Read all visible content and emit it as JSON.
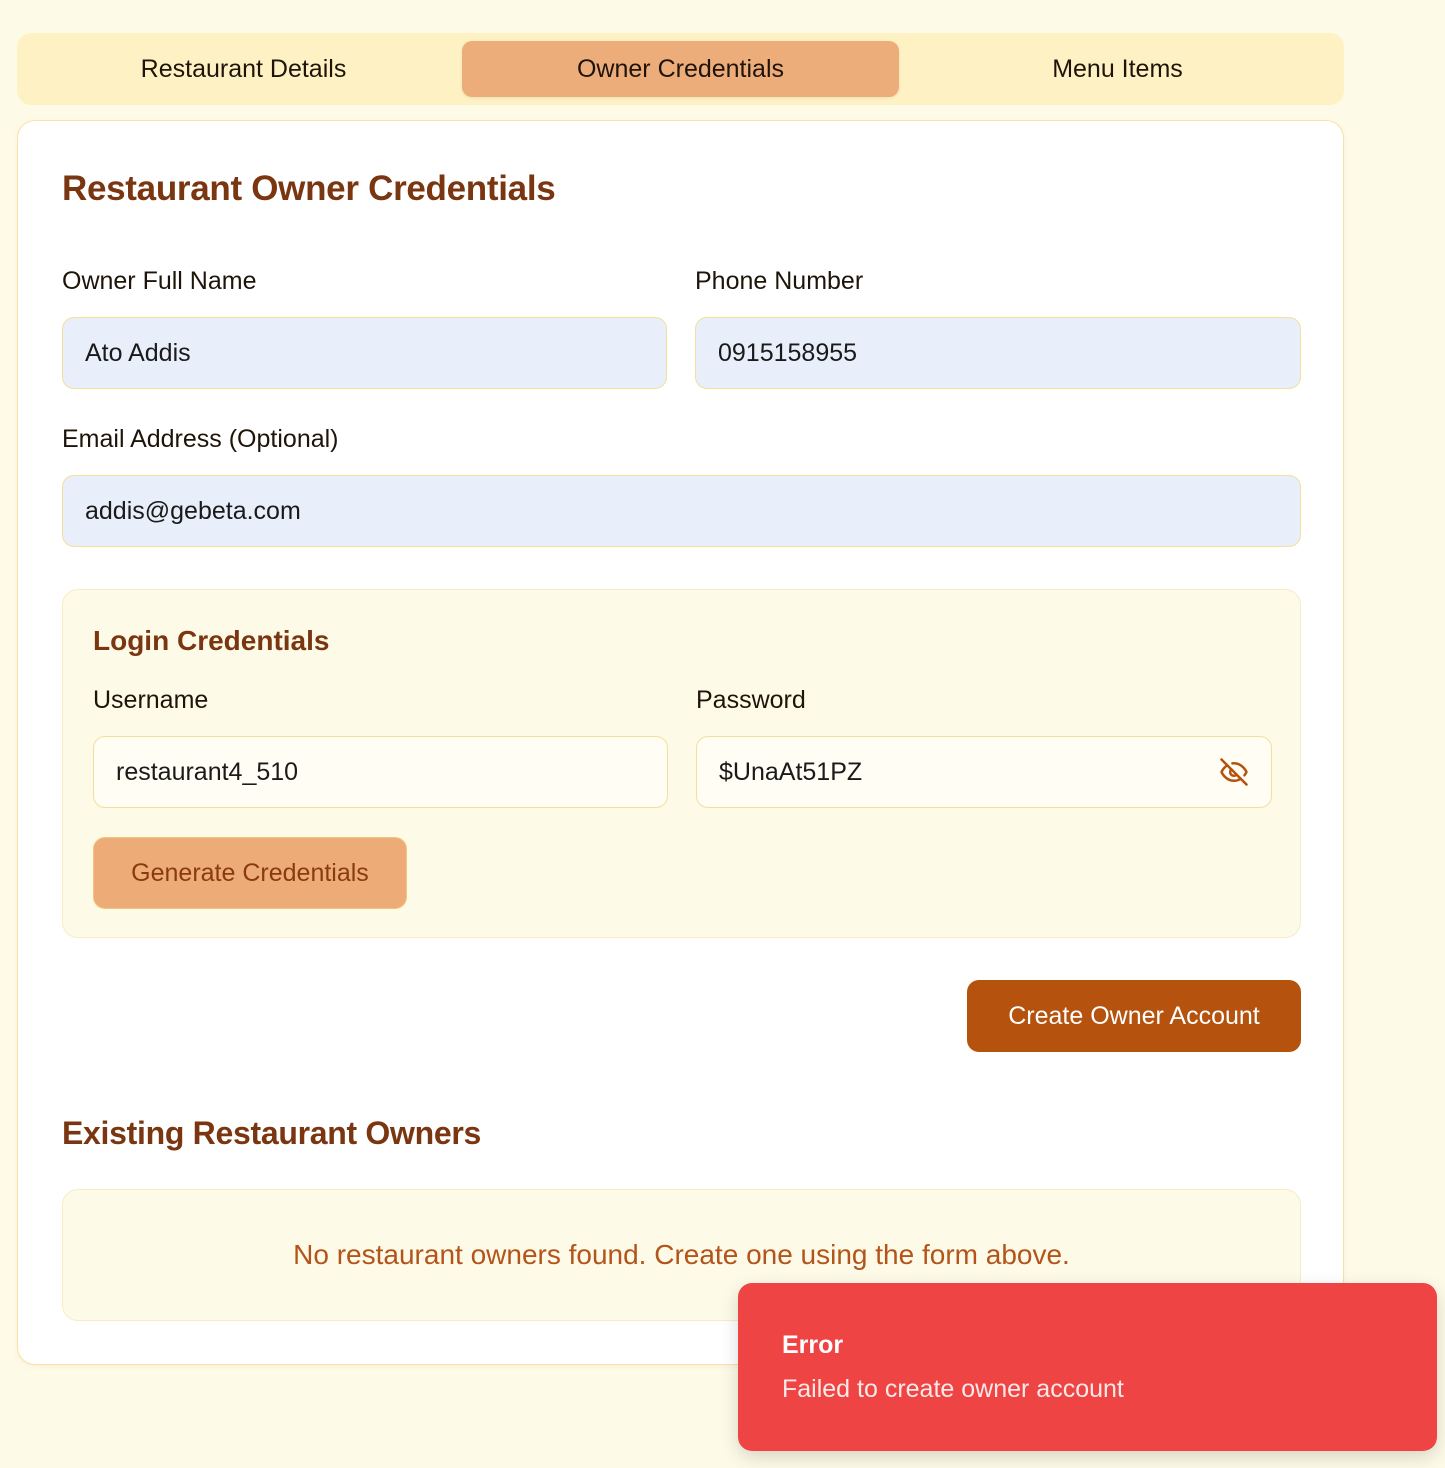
{
  "tabs": [
    {
      "label": "Restaurant Details",
      "active": false
    },
    {
      "label": "Owner Credentials",
      "active": true
    },
    {
      "label": "Menu Items",
      "active": false
    }
  ],
  "form": {
    "title": "Restaurant Owner Credentials",
    "owner_name": {
      "label": "Owner Full Name",
      "value": "Ato Addis"
    },
    "phone": {
      "label": "Phone Number",
      "value": "0915158955"
    },
    "email": {
      "label": "Email Address (Optional)",
      "value": "addis@gebeta.com"
    },
    "login": {
      "title": "Login Credentials",
      "username": {
        "label": "Username",
        "value": "restaurant4_510"
      },
      "password": {
        "label": "Password",
        "value": "$UnaAt51PZ",
        "icon": "eye-off-icon"
      },
      "generate_label": "Generate Credentials"
    },
    "create_label": "Create Owner Account"
  },
  "existing": {
    "title": "Existing Restaurant Owners",
    "empty_message": "No restaurant owners found. Create one using the form above."
  },
  "toast": {
    "title": "Error",
    "message": "Failed to create owner account"
  },
  "colors": {
    "accent": "#b5520d",
    "active_tab": "#edad7a",
    "heading": "#7a3511",
    "error": "#ef4444"
  }
}
